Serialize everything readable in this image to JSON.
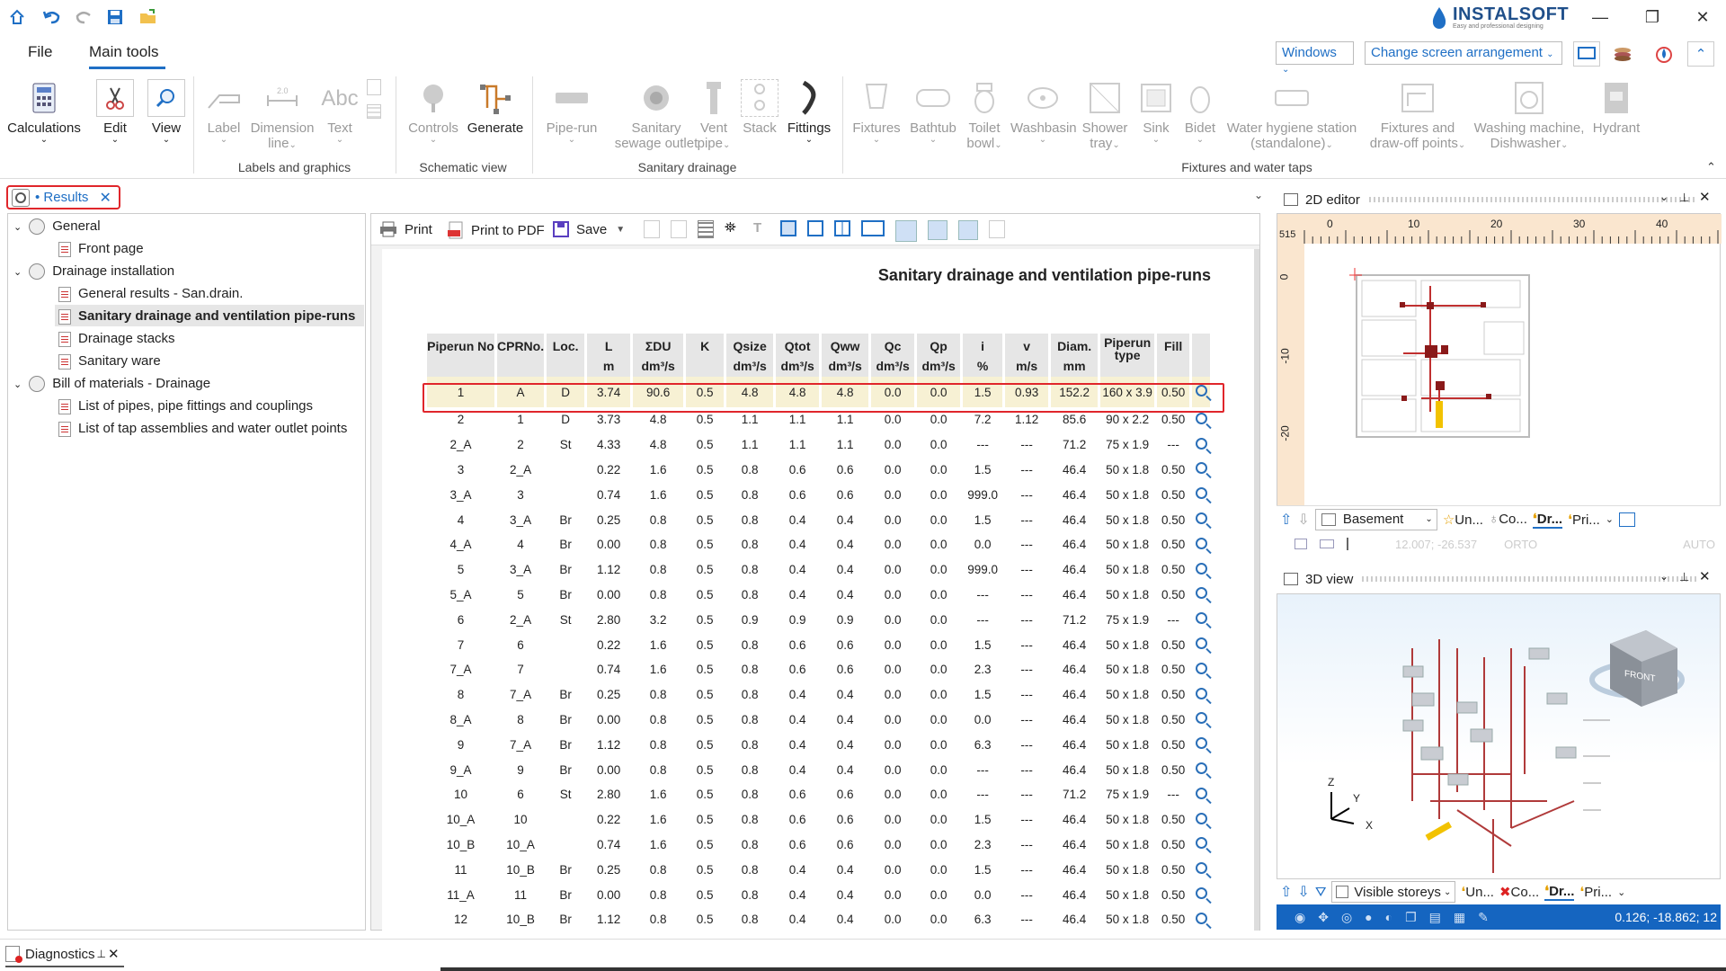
{
  "app": {
    "brand": "INSTALSOFT",
    "tagline": "Easy and professional designing"
  },
  "menu": {
    "file": "File",
    "main_tools": "Main tools"
  },
  "topbar": {
    "windows": "Windows",
    "change_arrangement": "Change screen arrangement"
  },
  "ribbon": {
    "calculations": "Calculations",
    "edit": "Edit",
    "view": "View",
    "label": "Label",
    "dimension_line": [
      "Dimension",
      "line"
    ],
    "text": "Text",
    "controls": "Controls",
    "generate": "Generate",
    "pipe_run": "Pipe-run",
    "sanitary_sewage_outlet": [
      "Sanitary",
      "sewage outlet"
    ],
    "vent_pipe": [
      "Vent",
      "pipe"
    ],
    "stack": "Stack",
    "fittings": "Fittings",
    "fixtures": "Fixtures",
    "bathtub": "Bathtub",
    "toilet_bowl": [
      "Toilet",
      "bowl"
    ],
    "washbasin": "Washbasin",
    "shower_tray": [
      "Shower",
      "tray"
    ],
    "sink": "Sink",
    "bidet": "Bidet",
    "water_hygiene_station": [
      "Water hygiene station",
      "(standalone)"
    ],
    "fixtures_draw_off": [
      "Fixtures and",
      "draw-off points"
    ],
    "washing_machine": [
      "Washing machine,",
      "Dishwasher"
    ],
    "hydrant": "Hydrant",
    "groups": {
      "labels_graphics": "Labels and graphics",
      "schematic_view": "Schematic view",
      "sanitary_drainage": "Sanitary drainage",
      "fixtures_water_taps": "Fixtures and water taps"
    }
  },
  "results_tab": {
    "label": "• Results"
  },
  "tree": {
    "general": "General",
    "front_page": "Front page",
    "drainage_installation": "Drainage installation",
    "general_results": "General results - San.drain.",
    "sanitary_pipe_runs": "Sanitary drainage and ventilation pipe-runs",
    "drainage_stacks": "Drainage stacks",
    "sanitary_ware": "Sanitary ware",
    "bom": "Bill of materials - Drainage",
    "list_pipes": "List of pipes, pipe fittings and couplings",
    "list_taps": "List of tap assemblies and water outlet points"
  },
  "toolbar": {
    "print": "Print",
    "print_pdf": "Print to PDF",
    "save": "Save"
  },
  "report": {
    "title": "Sanitary drainage and ventilation pipe-runs",
    "headers": [
      [
        "Piperun No",
        ""
      ],
      [
        "CPRNo.",
        ""
      ],
      [
        "Loc.",
        ""
      ],
      [
        "L",
        "m"
      ],
      [
        "ΣDU",
        "dm³/s"
      ],
      [
        "K",
        ""
      ],
      [
        "Qsize",
        "dm³/s"
      ],
      [
        "Qtot",
        "dm³/s"
      ],
      [
        "Qww",
        "dm³/s"
      ],
      [
        "Qc",
        "dm³/s"
      ],
      [
        "Qp",
        "dm³/s"
      ],
      [
        "i",
        "%"
      ],
      [
        "v",
        "m/s"
      ],
      [
        "Diam.",
        "mm"
      ],
      [
        "Piperun type",
        ""
      ],
      [
        "Fill",
        ""
      ]
    ],
    "rows": [
      [
        "1",
        "A",
        "D",
        "3.74",
        "90.6",
        "0.5",
        "4.8",
        "4.8",
        "4.8",
        "0.0",
        "0.0",
        "1.5",
        "0.93",
        "152.2",
        "160 x 3.9",
        "0.50"
      ],
      [
        "2",
        "1",
        "D",
        "3.73",
        "4.8",
        "0.5",
        "1.1",
        "1.1",
        "1.1",
        "0.0",
        "0.0",
        "7.2",
        "1.12",
        "85.6",
        "90 x 2.2",
        "0.50"
      ],
      [
        "2_A",
        "2",
        "St",
        "4.33",
        "4.8",
        "0.5",
        "1.1",
        "1.1",
        "1.1",
        "0.0",
        "0.0",
        "---",
        "---",
        "71.2",
        "75 x 1.9",
        "---"
      ],
      [
        "3",
        "2_A",
        "",
        "0.22",
        "1.6",
        "0.5",
        "0.8",
        "0.6",
        "0.6",
        "0.0",
        "0.0",
        "1.5",
        "---",
        "46.4",
        "50 x 1.8",
        "0.50"
      ],
      [
        "3_A",
        "3",
        "",
        "0.74",
        "1.6",
        "0.5",
        "0.8",
        "0.6",
        "0.6",
        "0.0",
        "0.0",
        "999.0",
        "---",
        "46.4",
        "50 x 1.8",
        "0.50"
      ],
      [
        "4",
        "3_A",
        "Br",
        "0.25",
        "0.8",
        "0.5",
        "0.8",
        "0.4",
        "0.4",
        "0.0",
        "0.0",
        "1.5",
        "---",
        "46.4",
        "50 x 1.8",
        "0.50"
      ],
      [
        "4_A",
        "4",
        "Br",
        "0.00",
        "0.8",
        "0.5",
        "0.8",
        "0.4",
        "0.4",
        "0.0",
        "0.0",
        "0.0",
        "---",
        "46.4",
        "50 x 1.8",
        "0.50"
      ],
      [
        "5",
        "3_A",
        "Br",
        "1.12",
        "0.8",
        "0.5",
        "0.8",
        "0.4",
        "0.4",
        "0.0",
        "0.0",
        "999.0",
        "---",
        "46.4",
        "50 x 1.8",
        "0.50"
      ],
      [
        "5_A",
        "5",
        "Br",
        "0.00",
        "0.8",
        "0.5",
        "0.8",
        "0.4",
        "0.4",
        "0.0",
        "0.0",
        "---",
        "---",
        "46.4",
        "50 x 1.8",
        "0.50"
      ],
      [
        "6",
        "2_A",
        "St",
        "2.80",
        "3.2",
        "0.5",
        "0.9",
        "0.9",
        "0.9",
        "0.0",
        "0.0",
        "---",
        "---",
        "71.2",
        "75 x 1.9",
        "---"
      ],
      [
        "7",
        "6",
        "",
        "0.22",
        "1.6",
        "0.5",
        "0.8",
        "0.6",
        "0.6",
        "0.0",
        "0.0",
        "1.5",
        "---",
        "46.4",
        "50 x 1.8",
        "0.50"
      ],
      [
        "7_A",
        "7",
        "",
        "0.74",
        "1.6",
        "0.5",
        "0.8",
        "0.6",
        "0.6",
        "0.0",
        "0.0",
        "2.3",
        "---",
        "46.4",
        "50 x 1.8",
        "0.50"
      ],
      [
        "8",
        "7_A",
        "Br",
        "0.25",
        "0.8",
        "0.5",
        "0.8",
        "0.4",
        "0.4",
        "0.0",
        "0.0",
        "1.5",
        "---",
        "46.4",
        "50 x 1.8",
        "0.50"
      ],
      [
        "8_A",
        "8",
        "Br",
        "0.00",
        "0.8",
        "0.5",
        "0.8",
        "0.4",
        "0.4",
        "0.0",
        "0.0",
        "0.0",
        "---",
        "46.4",
        "50 x 1.8",
        "0.50"
      ],
      [
        "9",
        "7_A",
        "Br",
        "1.12",
        "0.8",
        "0.5",
        "0.8",
        "0.4",
        "0.4",
        "0.0",
        "0.0",
        "6.3",
        "---",
        "46.4",
        "50 x 1.8",
        "0.50"
      ],
      [
        "9_A",
        "9",
        "Br",
        "0.00",
        "0.8",
        "0.5",
        "0.8",
        "0.4",
        "0.4",
        "0.0",
        "0.0",
        "---",
        "---",
        "46.4",
        "50 x 1.8",
        "0.50"
      ],
      [
        "10",
        "6",
        "St",
        "2.80",
        "1.6",
        "0.5",
        "0.8",
        "0.6",
        "0.6",
        "0.0",
        "0.0",
        "---",
        "---",
        "71.2",
        "75 x 1.9",
        "---"
      ],
      [
        "10_A",
        "10",
        "",
        "0.22",
        "1.6",
        "0.5",
        "0.8",
        "0.6",
        "0.6",
        "0.0",
        "0.0",
        "1.5",
        "---",
        "46.4",
        "50 x 1.8",
        "0.50"
      ],
      [
        "10_B",
        "10_A",
        "",
        "0.74",
        "1.6",
        "0.5",
        "0.8",
        "0.6",
        "0.6",
        "0.0",
        "0.0",
        "2.3",
        "---",
        "46.4",
        "50 x 1.8",
        "0.50"
      ],
      [
        "11",
        "10_B",
        "Br",
        "0.25",
        "0.8",
        "0.5",
        "0.8",
        "0.4",
        "0.4",
        "0.0",
        "0.0",
        "1.5",
        "---",
        "46.4",
        "50 x 1.8",
        "0.50"
      ],
      [
        "11_A",
        "11",
        "Br",
        "0.00",
        "0.8",
        "0.5",
        "0.8",
        "0.4",
        "0.4",
        "0.0",
        "0.0",
        "0.0",
        "---",
        "46.4",
        "50 x 1.8",
        "0.50"
      ],
      [
        "12",
        "10_B",
        "Br",
        "1.12",
        "0.8",
        "0.5",
        "0.8",
        "0.4",
        "0.4",
        "0.0",
        "0.0",
        "6.3",
        "---",
        "46.4",
        "50 x 1.8",
        "0.50"
      ]
    ]
  },
  "editor2d": {
    "title": "2D editor",
    "ruler_h": [
      "0",
      "10",
      "20",
      "30",
      "40"
    ],
    "ruler_v": [
      "0",
      "-10",
      "-20"
    ],
    "corner": "515",
    "storey": "Basement",
    "tabs": [
      "Un...",
      "Co...",
      "Dr...",
      "Pri..."
    ],
    "coords": "12.007; -26.537",
    "orto": "ORTO",
    "auto": "AUTO"
  },
  "view3d": {
    "title": "3D view",
    "visible_storeys": "Visible storeys",
    "tabs": [
      "Un...",
      "Co...",
      "Dr...",
      "Pri..."
    ],
    "coords": "0.126; -18.862; 12",
    "cube_front": "FRONT",
    "axes": {
      "z": "Z",
      "y": "Y",
      "x": "X"
    }
  },
  "diagnostics": {
    "label": "Diagnostics"
  },
  "colors": {
    "accent": "#1f6fc5",
    "highlight_border": "#e0262b",
    "row_highlight": "#f7f1d4",
    "status_blue": "#1565c0"
  }
}
